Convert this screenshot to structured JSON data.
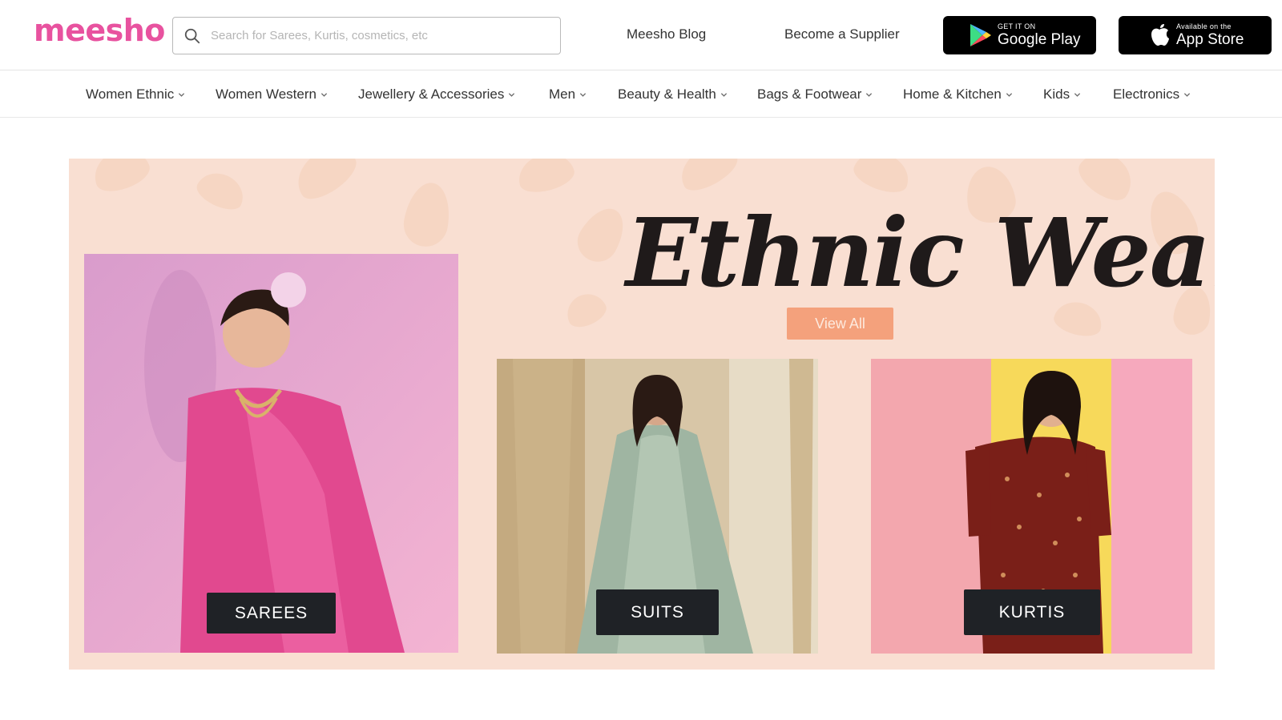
{
  "header": {
    "logo": "meesho",
    "search_placeholder": "Search for Sarees, Kurtis, cosmetics, etc",
    "links": [
      "Meesho Blog",
      "Become a Supplier"
    ],
    "google_play": {
      "small": "GET IT ON",
      "big": "Google Play"
    },
    "app_store": {
      "small": "Available on the",
      "big": "App Store"
    }
  },
  "nav": {
    "items": [
      "Women Ethnic",
      "Women Western",
      "Jewellery & Accessories",
      "Men",
      "Beauty & Health",
      "Bags & Footwear",
      "Home & Kitchen",
      "Kids",
      "Electronics"
    ]
  },
  "banner": {
    "title": "Ethnic Wear",
    "view_all": "View All",
    "cards": [
      "SAREES",
      "SUITS",
      "KURTIS"
    ]
  },
  "colors": {
    "brand": "#e8529f",
    "banner_bg": "#f9dfd2",
    "view_all_bg": "#f4a17c",
    "label_bg": "#1f2226"
  }
}
